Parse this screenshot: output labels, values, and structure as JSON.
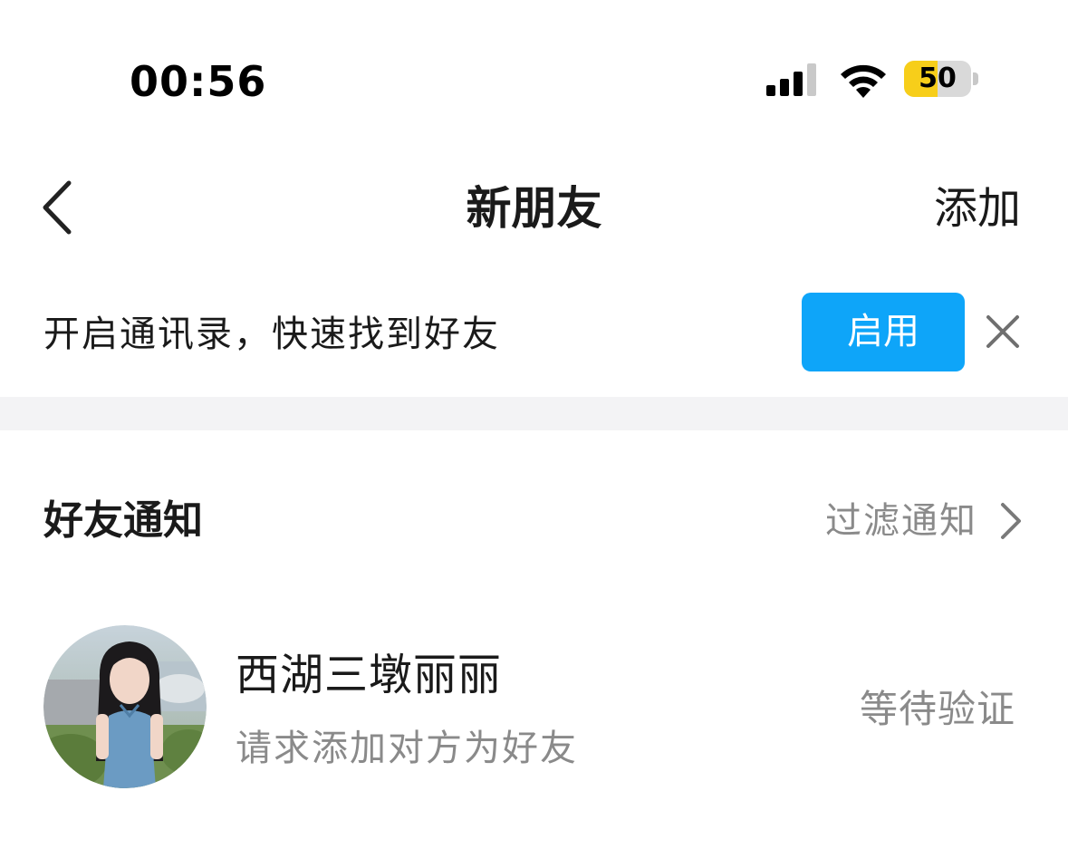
{
  "status_bar": {
    "time": "00:56",
    "battery_level": "50",
    "battery_fraction": 0.5,
    "battery_color": "#f7ce1a",
    "signal_icon": "cellular-signal-icon",
    "wifi_icon": "wifi-icon"
  },
  "nav": {
    "back_icon": "chevron-left-icon",
    "title": "新朋友",
    "action_label": "添加"
  },
  "contacts_banner": {
    "text": "开启通讯录，快速找到好友",
    "enable_label": "启用",
    "enable_color": "#0ea5f9",
    "close_icon": "close-icon"
  },
  "friend_notifications": {
    "title": "好友通知",
    "filter_label": "过滤通知",
    "filter_icon": "chevron-right-icon",
    "requests": [
      {
        "name": "西湖三墩丽丽",
        "message": "请求添加对方为好友",
        "status": "等待验证"
      }
    ]
  }
}
